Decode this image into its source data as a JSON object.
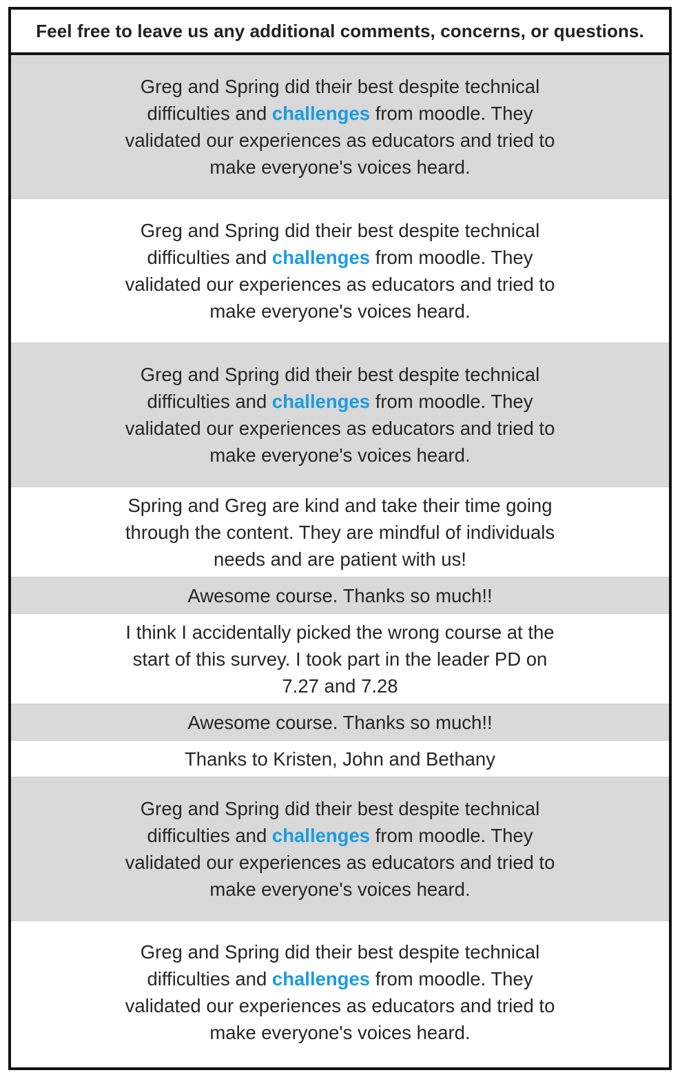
{
  "header": {
    "title": "Feel free to leave us any additional comments, concerns, or questions."
  },
  "comments": [
    {
      "before": "Greg and Spring did their best despite technical difficulties and ",
      "highlight": "challenges",
      "after": " from moodle. They validated our experiences as educators and tried to make everyone's voices heard."
    },
    {
      "before": "Greg and Spring did their best despite technical difficulties and ",
      "highlight": "challenges",
      "after": " from moodle. They validated our experiences as educators and tried to make everyone's voices heard."
    },
    {
      "before": "Greg and Spring did their best despite technical difficulties and ",
      "highlight": "challenges",
      "after": " from moodle. They validated our experiences as educators and tried to make everyone's voices heard."
    },
    {
      "text": "Spring and Greg are kind and take their time going through the content. They are mindful of individuals needs and are patient with us!"
    },
    {
      "text": "Awesome course. Thanks so much!!"
    },
    {
      "text": "I think I accidentally picked the wrong course at the start of this survey. I took part in the leader PD on 7.27 and 7.28"
    },
    {
      "text": "Awesome course. Thanks so much!!"
    },
    {
      "text": "Thanks to Kristen, John and Bethany"
    },
    {
      "before": "Greg and Spring did their best despite technical difficulties and ",
      "highlight": "challenges",
      "after": " from moodle. They validated our experiences as educators and tried to make everyone's voices heard."
    },
    {
      "before": "Greg and Spring did their best despite technical difficulties and ",
      "highlight": "challenges",
      "after": " from moodle. They validated our experiences as educators and tried to make everyone's voices heard."
    }
  ],
  "colors": {
    "highlight": "#1a9ce0",
    "row_shade": "#d9d9d9",
    "border": "#111111"
  }
}
